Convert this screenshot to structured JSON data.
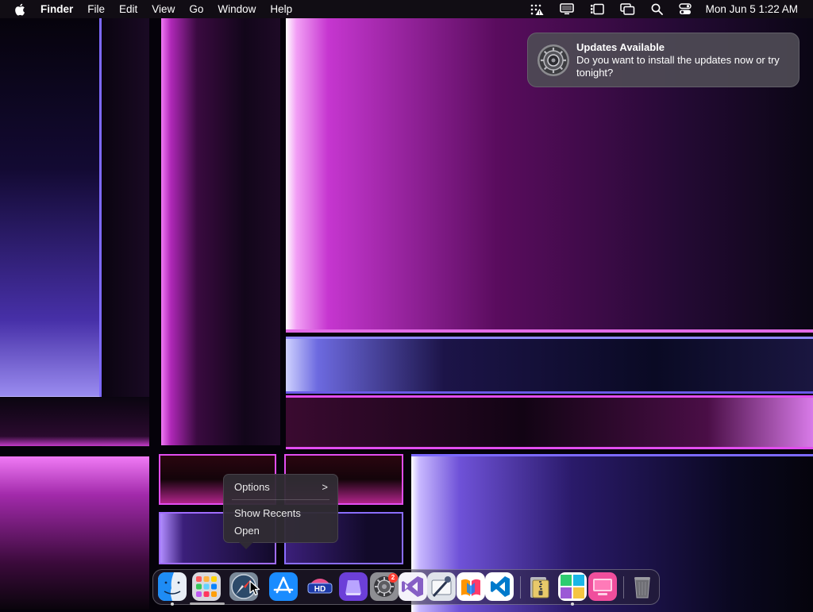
{
  "menubar": {
    "app_name": "Finder",
    "menus": [
      "File",
      "Edit",
      "View",
      "Go",
      "Window",
      "Help"
    ],
    "status_icons": [
      "activity-monitor-icon",
      "display-icon",
      "stage-manager-icon",
      "screen-mirroring-icon",
      "spotlight-search-icon",
      "control-center-icon"
    ],
    "clock": "Mon Jun 5  1:22 AM"
  },
  "notification": {
    "icon": "system-settings-gear-icon",
    "title": "Updates Available",
    "body": "Do you want to install the updates now or try tonight?"
  },
  "context_menu": {
    "items": [
      {
        "label": "Options",
        "submenu_indicator": ">"
      },
      {
        "label": "Show Recents"
      },
      {
        "label": "Open"
      }
    ]
  },
  "dock": {
    "apps": [
      {
        "name": "finder-icon",
        "running": true
      },
      {
        "name": "launchpad-icon",
        "running": false
      },
      {
        "name": "safari-icon",
        "running": false
      },
      {
        "name": "app-store-icon",
        "running": false
      },
      {
        "name": "hd-app-icon",
        "running": false
      },
      {
        "name": "purple-app-icon",
        "running": false
      },
      {
        "name": "system-settings-icon",
        "running": false,
        "badge": "2"
      },
      {
        "name": "visual-studio-icon",
        "running": false
      },
      {
        "name": "xcode-instruments-icon",
        "running": false
      },
      {
        "name": "books-icon",
        "running": false
      },
      {
        "name": "vscode-icon",
        "running": false
      },
      {
        "name": "archive-utility-icon",
        "running": false
      },
      {
        "name": "preview-grid-icon",
        "running": true
      },
      {
        "name": "pink-app-icon",
        "running": false
      },
      {
        "name": "trash-icon",
        "running": false
      }
    ]
  },
  "colors": {
    "menubar_bg": "#120e16",
    "notification_bg": "#4e4a54",
    "accent_magenta": "#e24df0",
    "accent_violet": "#8a6dff",
    "badge_red": "#ff3b30"
  }
}
